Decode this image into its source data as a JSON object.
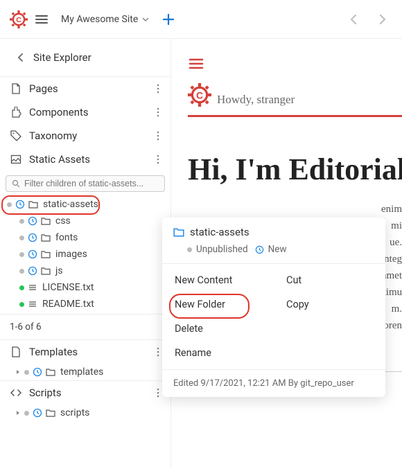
{
  "topbar": {
    "site_name": "My Awesome Site"
  },
  "explorer": {
    "title": "Site Explorer",
    "nav_items": [
      {
        "label": "Pages",
        "icon": "page-icon"
      },
      {
        "label": "Components",
        "icon": "puzzle-icon"
      },
      {
        "label": "Taxonomy",
        "icon": "tag-icon"
      },
      {
        "label": "Static Assets",
        "icon": "assets-icon"
      }
    ],
    "filter_placeholder": "Filter children of static-assets...",
    "root": {
      "label": "static-assets"
    },
    "children": [
      {
        "label": "css",
        "dot": "grey",
        "type": "folder"
      },
      {
        "label": "fonts",
        "dot": "grey",
        "type": "folder"
      },
      {
        "label": "images",
        "dot": "grey",
        "type": "folder"
      },
      {
        "label": "js",
        "dot": "grey",
        "type": "folder"
      },
      {
        "label": "LICENSE.txt",
        "dot": "green",
        "type": "file"
      },
      {
        "label": "README.txt",
        "dot": "green",
        "type": "file"
      }
    ],
    "count_label": "1-6 of 6",
    "templates_label": "Templates",
    "templates_child": "templates",
    "scripts_label": "Scripts",
    "scripts_child": "scripts"
  },
  "content": {
    "howdy": "Howdy, stranger",
    "heading": "Hi, I'm Editorial",
    "paragraph_fragments": [
      "enim mi",
      "ue. Integ",
      "er, amet",
      "maximus",
      "m. Loren"
    ]
  },
  "context_menu": {
    "title": "static-assets",
    "status_unpublished": "Unpublished",
    "status_new": "New",
    "col1": [
      "New Content",
      "New Folder",
      "Delete",
      "Rename"
    ],
    "col2": [
      "Cut",
      "Copy"
    ],
    "footer": "Edited 9/17/2021, 12:21 AM By git_repo_user"
  },
  "colors": {
    "accent": "#d4403a",
    "highlight_ring": "#e0362b",
    "blue_clock": "#1e88e5",
    "grey_dot": "#bbbbbb",
    "green_dot": "#27c35a",
    "plus_blue": "#1976d2"
  }
}
